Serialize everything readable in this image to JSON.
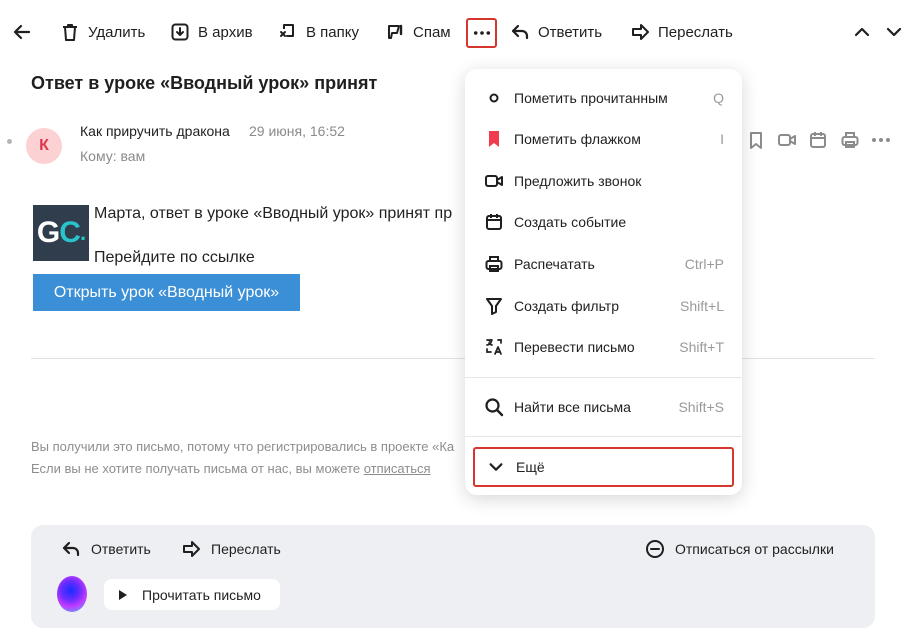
{
  "toolbar": {
    "delete_label": "Удалить",
    "archive_label": "В архив",
    "folder_label": "В папку",
    "spam_label": "Спам",
    "reply_label": "Ответить",
    "forward_label": "Переслать"
  },
  "mail": {
    "subject": "Ответ в уроке «Вводный урок» принят",
    "avatar_letter": "К",
    "sender": "Как приручить дракона",
    "date": "29 июня, 16:52",
    "to": "Кому: вам",
    "body_line1": "Марта, ответ в уроке «Вводный урок» принят пр",
    "body_line2": "Перейдите по ссылке",
    "cta_label": "Открыть урок «Вводный урок»",
    "footer_line1": "Вы получили это письмо, потому что регистрировались в проекте «Ка",
    "footer_line2_prefix": "Если вы не хотите получать письма от нас, вы можете ",
    "unsubscribe_link": "отписаться",
    "logo_text_g": "G",
    "logo_text_c": "C",
    "logo_text_dot": "."
  },
  "panel": {
    "reply_label": "Ответить",
    "forward_label": "Переслать",
    "unsubscribe_label": "Отписаться от рассылки",
    "read_label": "Прочитать письмо"
  },
  "menu": {
    "items": [
      {
        "label": "Пометить прочитанным",
        "shortcut": "Q"
      },
      {
        "label": "Пометить флажком",
        "shortcut": "I"
      },
      {
        "label": "Предложить звонок",
        "shortcut": ""
      },
      {
        "label": "Создать событие",
        "shortcut": ""
      },
      {
        "label": "Распечатать",
        "shortcut": "Ctrl+P"
      },
      {
        "label": "Создать фильтр",
        "shortcut": "Shift+L"
      },
      {
        "label": "Перевести письмо",
        "shortcut": "Shift+T"
      },
      {
        "label": "Найти все письма",
        "shortcut": "Shift+S"
      }
    ],
    "more_label": "Ещё"
  },
  "colors": {
    "accent_red": "#d7362f",
    "flag_red": "#f23b4f",
    "cta_blue": "#3b8fd6"
  },
  "icons": [
    "back-arrow-icon",
    "trash-icon",
    "archive-icon",
    "folder-move-icon",
    "spam-icon",
    "more-dots-icon",
    "reply-icon",
    "forward-icon",
    "chevron-up-icon",
    "chevron-down-icon",
    "bookmark-icon",
    "video-call-icon",
    "calendar-icon",
    "printer-icon",
    "dot-icon",
    "flag-icon",
    "filter-icon",
    "translate-icon",
    "search-icon",
    "unsubscribe-icon",
    "play-icon"
  ]
}
